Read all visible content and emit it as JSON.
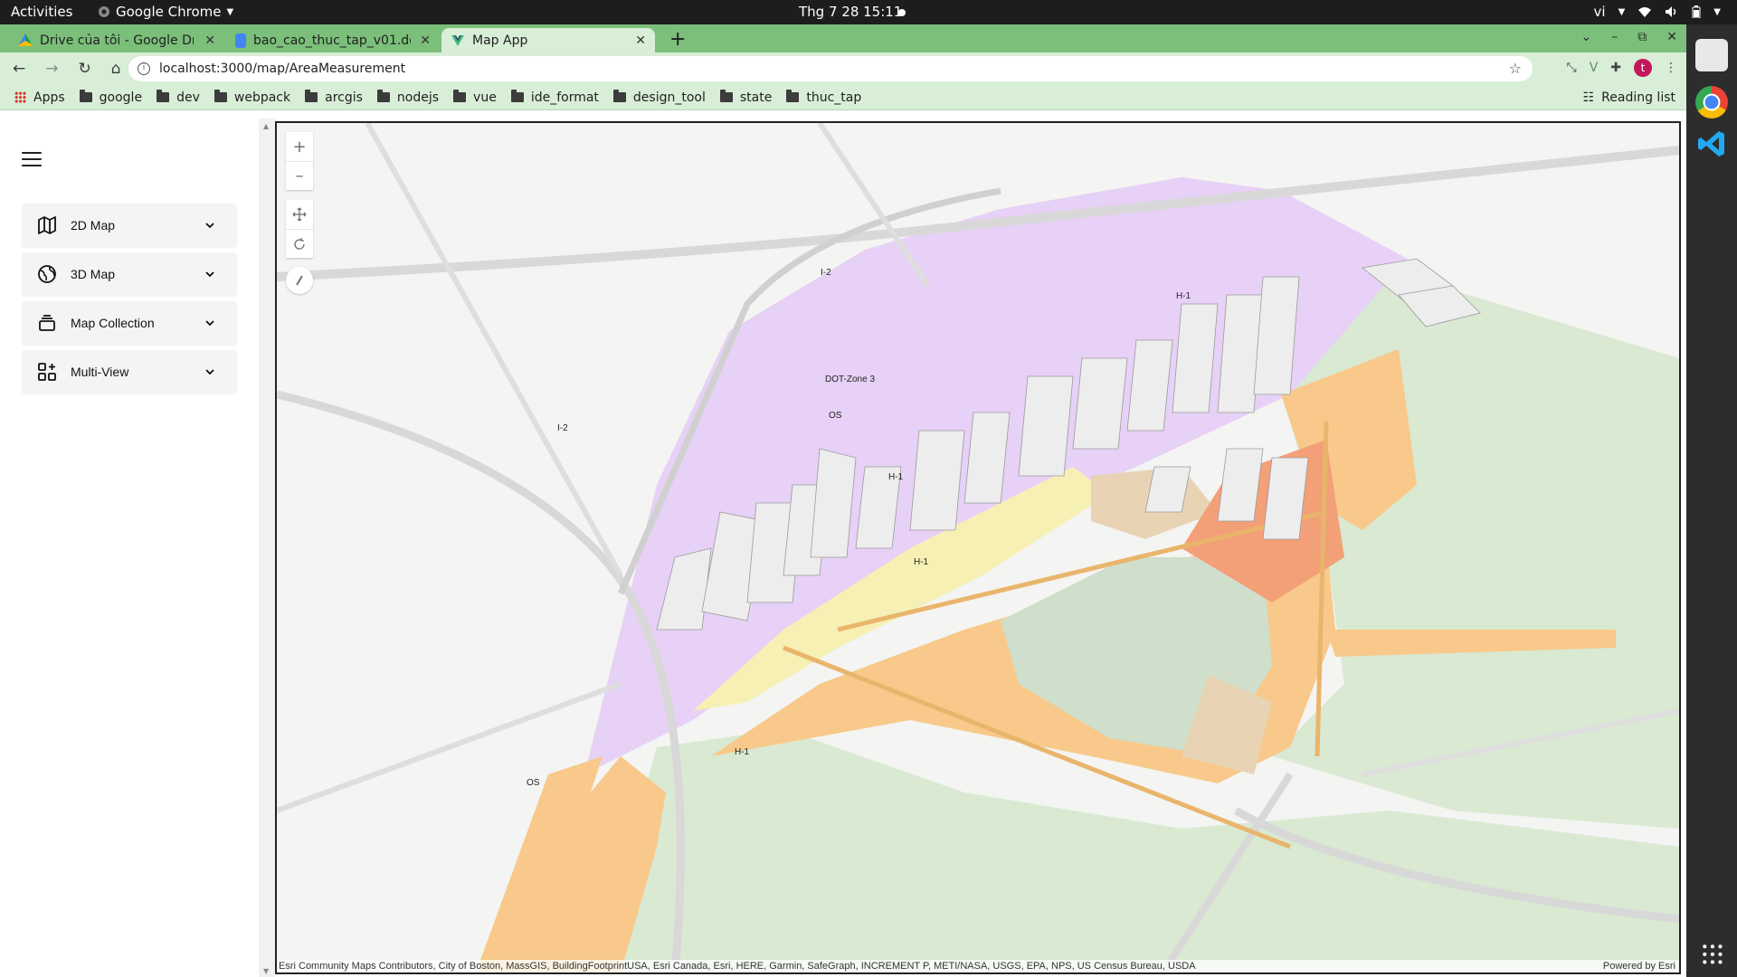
{
  "system": {
    "activities": "Activities",
    "app_name": "Google Chrome",
    "clock": "Thg 7 28  15:11",
    "lang": "vi"
  },
  "tabs": [
    {
      "title": "Drive của tôi - Google Dri"
    },
    {
      "title": "bao_cao_thuc_tap_v01.dc"
    },
    {
      "title": "Map App"
    }
  ],
  "address": {
    "url": "localhost:3000/map/AreaMeasurement"
  },
  "bookmarks": {
    "apps": "Apps",
    "folders": [
      "google",
      "dev",
      "webpack",
      "arcgis",
      "nodejs",
      "vue",
      "ide_format",
      "design_tool",
      "state",
      "thuc_tap"
    ],
    "reading_list": "Reading list"
  },
  "sidebar": {
    "items": [
      {
        "label": "2D Map",
        "icon": "map-icon"
      },
      {
        "label": "3D Map",
        "icon": "globe-icon"
      },
      {
        "label": "Map Collection",
        "icon": "layers-icon"
      },
      {
        "label": "Multi-View",
        "icon": "grid-plus-icon"
      }
    ]
  },
  "map": {
    "zone_labels": [
      "I-2",
      "I-2",
      "H-1",
      "DOT-Zone 3",
      "OS",
      "H-1",
      "H-1",
      "H-1",
      "OS"
    ],
    "attribution": "Esri Community Maps Contributors, City of Boston, MassGIS, BuildingFootprintUSA, Esri Canada, Esri, HERE, Garmin, SafeGraph, INCREMENT P, METI/NASA, USGS, EPA, NPS, US Census Bureau, USDA",
    "powered_by": "Powered by Esri",
    "colors": {
      "industrial": "#e9d2f7",
      "commercial": "#f9cb8b",
      "residential": "#d7e8cf",
      "open_space": "#e9d5b8",
      "mixed": "#f6f0b4",
      "highlight": "#f2a07b"
    }
  }
}
